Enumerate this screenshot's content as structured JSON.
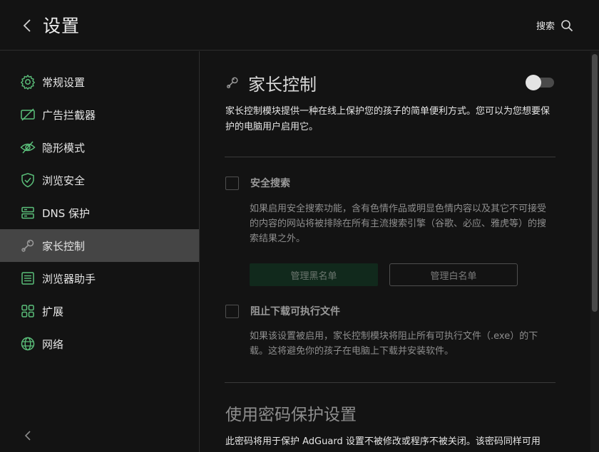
{
  "header": {
    "title": "设置",
    "search_label": "搜索",
    "back_icon": "chevron-left-icon",
    "search_icon": "search-icon"
  },
  "sidebar": {
    "accent_color": "#5bbf7a",
    "items": [
      {
        "label": "常规设置",
        "icon": "gear-icon",
        "active": false
      },
      {
        "label": "广告拦截器",
        "icon": "ad-block-icon",
        "active": false
      },
      {
        "label": "隐形模式",
        "icon": "eye-off-icon",
        "active": false
      },
      {
        "label": "浏览安全",
        "icon": "shield-icon",
        "active": false
      },
      {
        "label": "DNS 保护",
        "icon": "server-icon",
        "active": false
      },
      {
        "label": "家长控制",
        "icon": "rattle-icon",
        "active": true
      },
      {
        "label": "浏览器助手",
        "icon": "browser-assistant-icon",
        "active": false
      },
      {
        "label": "扩展",
        "icon": "extensions-icon",
        "active": false
      },
      {
        "label": "网络",
        "icon": "globe-icon",
        "active": false
      }
    ],
    "collapse_icon": "chevron-left-icon"
  },
  "main": {
    "section_title": "家长控制",
    "section_icon": "rattle-icon",
    "toggle_enabled": false,
    "description": "家长控制模块提供一种在线上保护您的孩子的简单便利方式。您可以为您想要保护的电脑用户启用它。",
    "safe_search": {
      "label": "安全搜索",
      "checked": false,
      "description": "如果启用安全搜索功能，含有色情作品或明显色情内容以及其它不可接受的内容的网站将被排除在所有主流搜索引擎（谷歌、必应、雅虎等）的搜索结果之外。"
    },
    "buttons": {
      "blacklist": "管理黑名单",
      "whitelist": "管理白名单"
    },
    "block_downloads": {
      "label": "阻止下载可执行文件",
      "checked": false,
      "description": "如果该设置被启用，家长控制模块将阻止所有可执行文件（.exe）的下载。这将避免你的孩子在电脑上下载并安装软件。"
    },
    "password": {
      "title": "使用密码保护设置",
      "description": "此密码将用于保护 AdGuard 设置不被修改或程序不被关闭。该密码同样可用"
    }
  }
}
